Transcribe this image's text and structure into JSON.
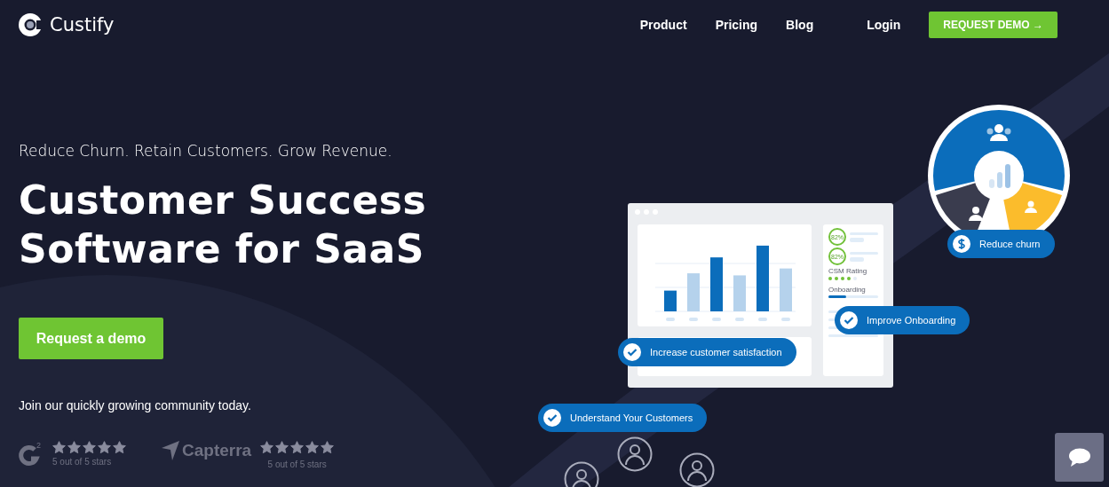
{
  "nav": {
    "logo": "Custify",
    "links": [
      {
        "label": "Product"
      },
      {
        "label": "Pricing"
      },
      {
        "label": "Blog"
      }
    ],
    "login": "Login",
    "cta": "REQUEST DEMO →"
  },
  "hero": {
    "tagline": "Reduce Churn. Retain Customers. Grow Revenue.",
    "heading_lines": [
      "Customer Success",
      "Software for SaaS"
    ],
    "button": "Request a demo",
    "note": "Join our quickly growing community today."
  },
  "ratings": [
    {
      "kind": "g2",
      "superscript": "2",
      "stars": 5,
      "caption": "5 out of 5 stars"
    },
    {
      "kind": "capterra",
      "brand": "Capterra",
      "stars": 5,
      "caption": "5 out of 5 stars"
    }
  ],
  "dashboard": {
    "gauges": [
      "82%",
      "82%"
    ],
    "rating": {
      "label": "CSM Rating",
      "stars": 4
    },
    "progress_label": "Onboarding",
    "level": 0.35
  },
  "pills": [
    {
      "kind": "dollar",
      "label": "Reduce churn"
    },
    {
      "kind": "check",
      "label": "Improve Onboarding"
    },
    {
      "kind": "check",
      "label": "Increase customer satisfaction"
    },
    {
      "kind": "check",
      "label": "Understand Your Customers"
    }
  ]
}
